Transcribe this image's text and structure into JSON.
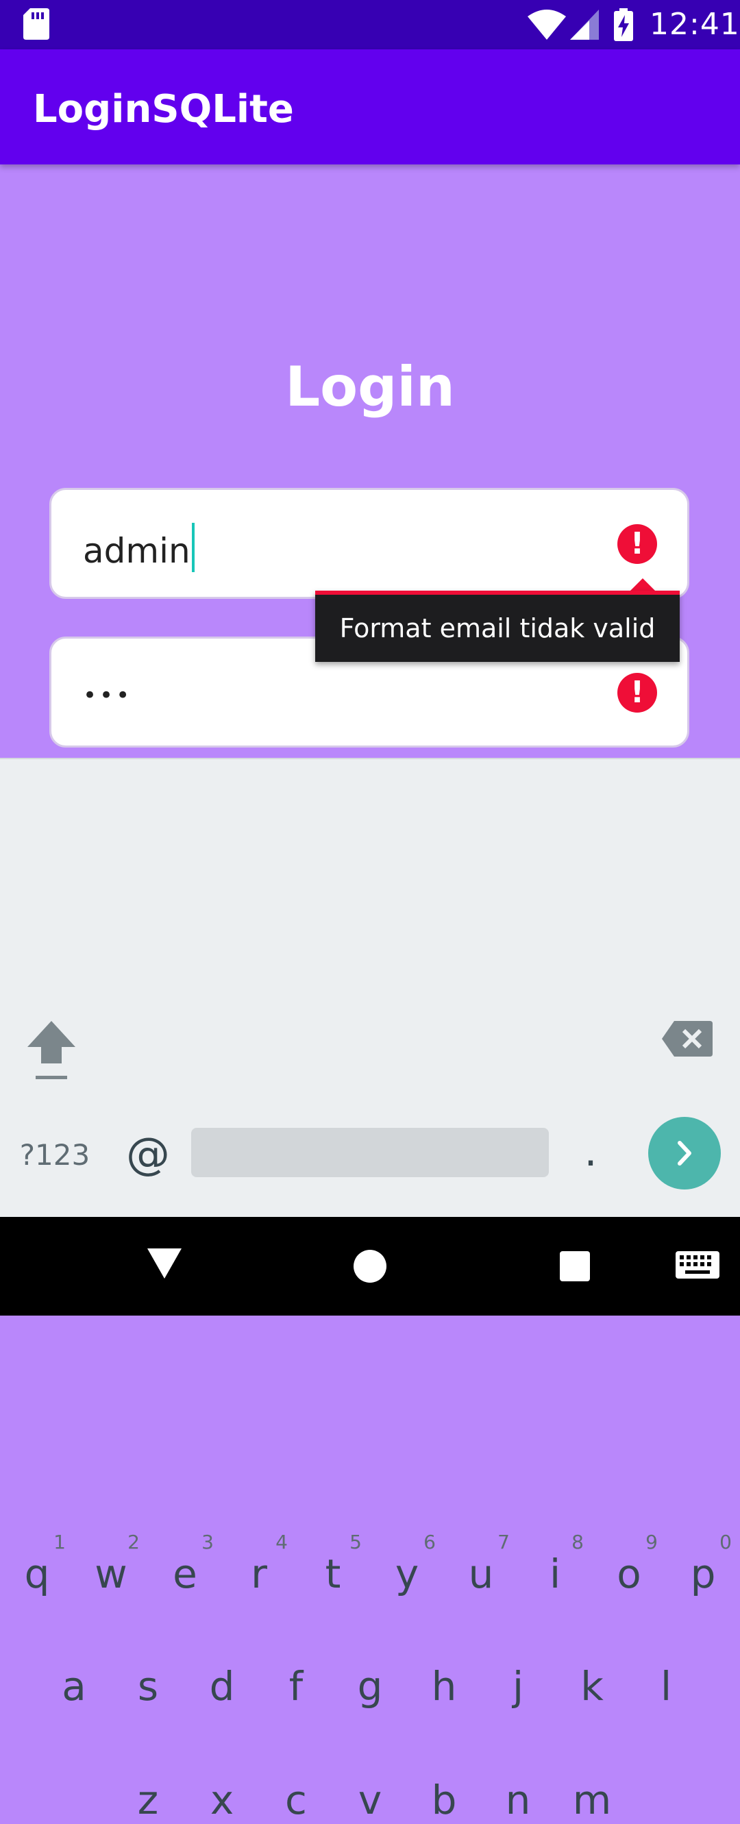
{
  "status_bar": {
    "time": "12:41",
    "icons": [
      "sd-card-icon",
      "wifi-icon",
      "cell-signal-icon",
      "battery-charging-icon"
    ],
    "background": "#3700b3"
  },
  "app_bar": {
    "title": "LoginSQLite",
    "background": "#6200ee"
  },
  "login": {
    "heading": "Login",
    "email_value": "admin",
    "password_value": "•••",
    "error_tooltip": "Format email tidak valid",
    "error_color": "#ef0e37",
    "page_background": "#b987fb"
  },
  "keyboard": {
    "row1": [
      {
        "key": "q",
        "hint": "1"
      },
      {
        "key": "w",
        "hint": "2"
      },
      {
        "key": "e",
        "hint": "3"
      },
      {
        "key": "r",
        "hint": "4"
      },
      {
        "key": "t",
        "hint": "5"
      },
      {
        "key": "y",
        "hint": "6"
      },
      {
        "key": "u",
        "hint": "7"
      },
      {
        "key": "i",
        "hint": "8"
      },
      {
        "key": "o",
        "hint": "9"
      },
      {
        "key": "p",
        "hint": "0"
      }
    ],
    "row2": [
      "a",
      "s",
      "d",
      "f",
      "g",
      "h",
      "j",
      "k",
      "l"
    ],
    "row3": [
      "z",
      "x",
      "c",
      "v",
      "b",
      "n",
      "m"
    ],
    "symbols_label": "?123",
    "at_label": "@",
    "period_label": ".",
    "accent": "#4db6ac"
  },
  "nav_bar": {
    "icons": [
      "back-icon",
      "home-icon",
      "recent-apps-icon",
      "keyboard-switch-icon"
    ]
  }
}
